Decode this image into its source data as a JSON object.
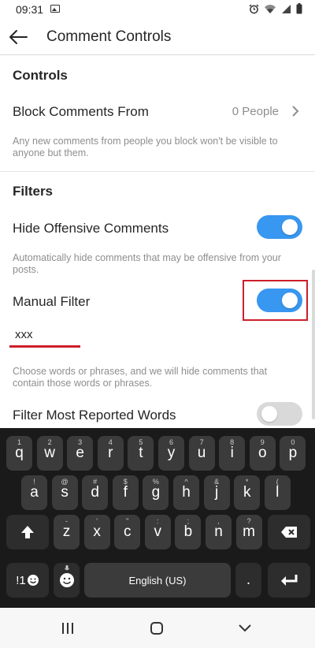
{
  "status_bar": {
    "time": "09:31"
  },
  "app_bar": {
    "title": "Comment Controls"
  },
  "controls": {
    "title": "Controls",
    "block_comments": {
      "label": "Block Comments From",
      "value": "0 People",
      "description": "Any new comments from people you block won't be visible to anyone but them."
    }
  },
  "filters": {
    "title": "Filters",
    "hide_offensive": {
      "label": "Hide Offensive Comments",
      "enabled": true,
      "description": "Automatically hide comments that may be offensive from your posts."
    },
    "manual_filter": {
      "label": "Manual Filter",
      "enabled": true,
      "words_value": "xxx",
      "description": "Choose words or phrases, and we will hide comments that contain those words or phrases."
    },
    "most_reported": {
      "label": "Filter Most Reported Words",
      "enabled": false
    }
  },
  "keyboard": {
    "row1": [
      {
        "key": "q",
        "sec": "1"
      },
      {
        "key": "w",
        "sec": "2"
      },
      {
        "key": "e",
        "sec": "3"
      },
      {
        "key": "r",
        "sec": "4"
      },
      {
        "key": "t",
        "sec": "5"
      },
      {
        "key": "y",
        "sec": "6"
      },
      {
        "key": "u",
        "sec": "7"
      },
      {
        "key": "i",
        "sec": "8"
      },
      {
        "key": "o",
        "sec": "9"
      },
      {
        "key": "p",
        "sec": "0"
      }
    ],
    "row2": [
      {
        "key": "a",
        "sec": "!"
      },
      {
        "key": "s",
        "sec": "@"
      },
      {
        "key": "d",
        "sec": "#"
      },
      {
        "key": "f",
        "sec": "$"
      },
      {
        "key": "g",
        "sec": "%"
      },
      {
        "key": "h",
        "sec": "^"
      },
      {
        "key": "j",
        "sec": "&"
      },
      {
        "key": "k",
        "sec": "*"
      },
      {
        "key": "l",
        "sec": "("
      }
    ],
    "row3": [
      {
        "key": "z",
        "sec": "-"
      },
      {
        "key": "x",
        "sec": "'"
      },
      {
        "key": "c",
        "sec": "\""
      },
      {
        "key": "v",
        "sec": ":"
      },
      {
        "key": "b",
        "sec": ";"
      },
      {
        "key": "n",
        "sec": ","
      },
      {
        "key": "m",
        "sec": "?"
      }
    ],
    "symbols_label": "!1",
    "space_label": "English (US)",
    "period_label": "."
  },
  "colors": {
    "accent": "#3897f0",
    "highlight": "#cc1f2a"
  }
}
